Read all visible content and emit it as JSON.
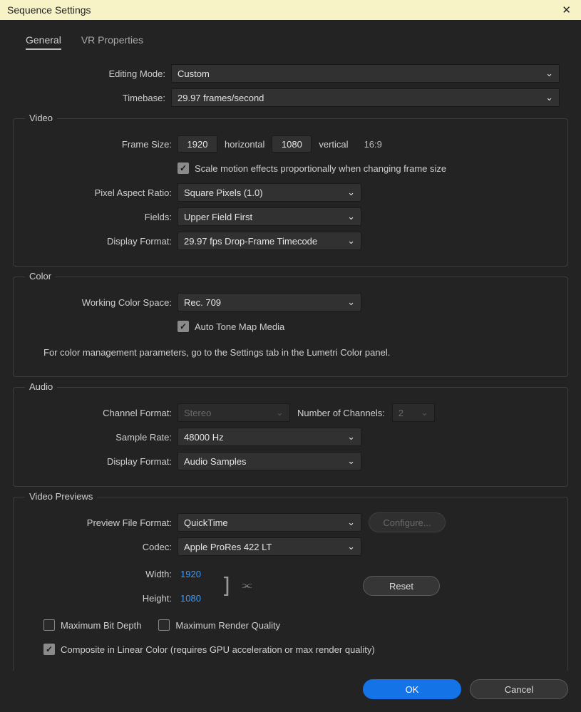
{
  "title": "Sequence Settings",
  "tabs": {
    "general": "General",
    "vr": "VR Properties"
  },
  "editingMode": {
    "label": "Editing Mode:",
    "value": "Custom"
  },
  "timebase": {
    "label": "Timebase:",
    "value": "29.97  frames/second"
  },
  "video": {
    "legend": "Video",
    "frameSize": {
      "label": "Frame Size:",
      "w": "1920",
      "wlabel": "horizontal",
      "h": "1080",
      "hlabel": "vertical",
      "aspect": "16:9"
    },
    "scaleMotion": {
      "label": "Scale motion effects proportionally when changing frame size"
    },
    "par": {
      "label": "Pixel Aspect Ratio:",
      "value": "Square Pixels (1.0)"
    },
    "fields": {
      "label": "Fields:",
      "value": "Upper Field First"
    },
    "dispFmt": {
      "label": "Display Format:",
      "value": "29.97 fps Drop-Frame Timecode"
    }
  },
  "color": {
    "legend": "Color",
    "space": {
      "label": "Working Color Space:",
      "value": "Rec. 709"
    },
    "autoTone": {
      "label": "Auto Tone Map Media"
    },
    "hint": "For color management parameters, go to the Settings tab in the Lumetri Color panel."
  },
  "audio": {
    "legend": "Audio",
    "channelFmt": {
      "label": "Channel Format:",
      "value": "Stereo"
    },
    "numChannels": {
      "label": "Number of Channels:",
      "value": "2"
    },
    "sampleRate": {
      "label": "Sample Rate:",
      "value": "48000 Hz"
    },
    "dispFmt": {
      "label": "Display Format:",
      "value": "Audio Samples"
    }
  },
  "previews": {
    "legend": "Video Previews",
    "fileFmt": {
      "label": "Preview File Format:",
      "value": "QuickTime"
    },
    "configure": "Configure...",
    "codec": {
      "label": "Codec:",
      "value": "Apple ProRes 422 LT"
    },
    "width": {
      "label": "Width:",
      "value": "1920"
    },
    "height": {
      "label": "Height:",
      "value": "1080"
    },
    "reset": "Reset",
    "maxBitDepth": "Maximum Bit Depth",
    "maxRenderQ": "Maximum Render Quality",
    "composite": "Composite in Linear Color (requires GPU acceleration or max render quality)"
  },
  "buttons": {
    "ok": "OK",
    "cancel": "Cancel"
  }
}
